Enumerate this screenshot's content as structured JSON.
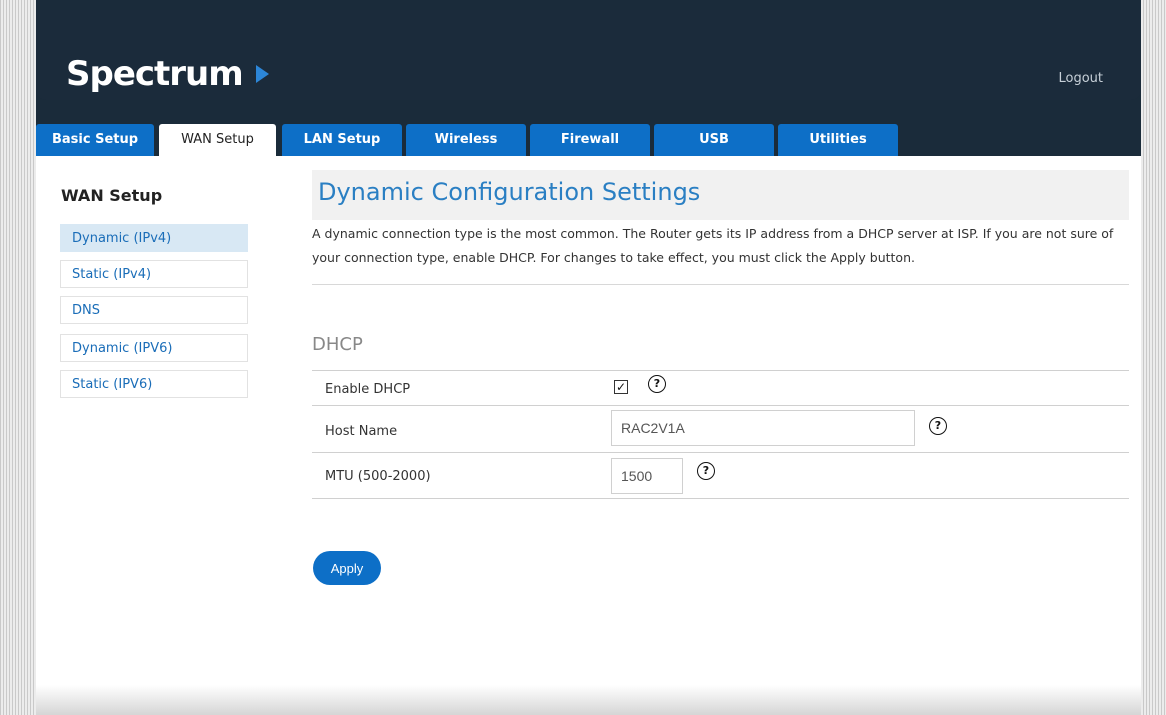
{
  "header": {
    "brand": "Spectrum",
    "logout_label": "Logout"
  },
  "tabs": [
    {
      "label": "Basic Setup",
      "active": false
    },
    {
      "label": "WAN Setup",
      "active": true
    },
    {
      "label": "LAN Setup",
      "active": false
    },
    {
      "label": "Wireless",
      "active": false
    },
    {
      "label": "Firewall",
      "active": false
    },
    {
      "label": "USB",
      "active": false
    },
    {
      "label": "Utilities",
      "active": false
    }
  ],
  "sidebar": {
    "title": "WAN Setup",
    "items": [
      {
        "label": "Dynamic (IPv4)",
        "active": true
      },
      {
        "label": "Static (IPv4)",
        "active": false
      },
      {
        "label": "DNS",
        "active": false
      },
      {
        "label": "Dynamic (IPV6)",
        "active": false
      },
      {
        "label": "Static (IPV6)",
        "active": false
      }
    ]
  },
  "main": {
    "title": "Dynamic Configuration Settings",
    "description": "A dynamic connection type is the most common. The Router gets its IP address from a DHCP server at ISP. If you are not sure of your connection type, enable DHCP. For changes to take effect, you must click the Apply button.",
    "section_title": "DHCP",
    "fields": {
      "enable_dhcp": {
        "label": "Enable DHCP",
        "checked": true,
        "check_glyph": "✓"
      },
      "host_name": {
        "label": "Host Name",
        "value": "RAC2V1A"
      },
      "mtu": {
        "label": "MTU (500-2000)",
        "value": "1500"
      }
    },
    "help_glyph": "?",
    "apply_label": "Apply"
  },
  "colors": {
    "accent": "#0d6fc7",
    "header_bg": "#1b2b3b",
    "title_blue": "#2a7fc3",
    "sidebar_active_bg": "#d8e8f4"
  }
}
